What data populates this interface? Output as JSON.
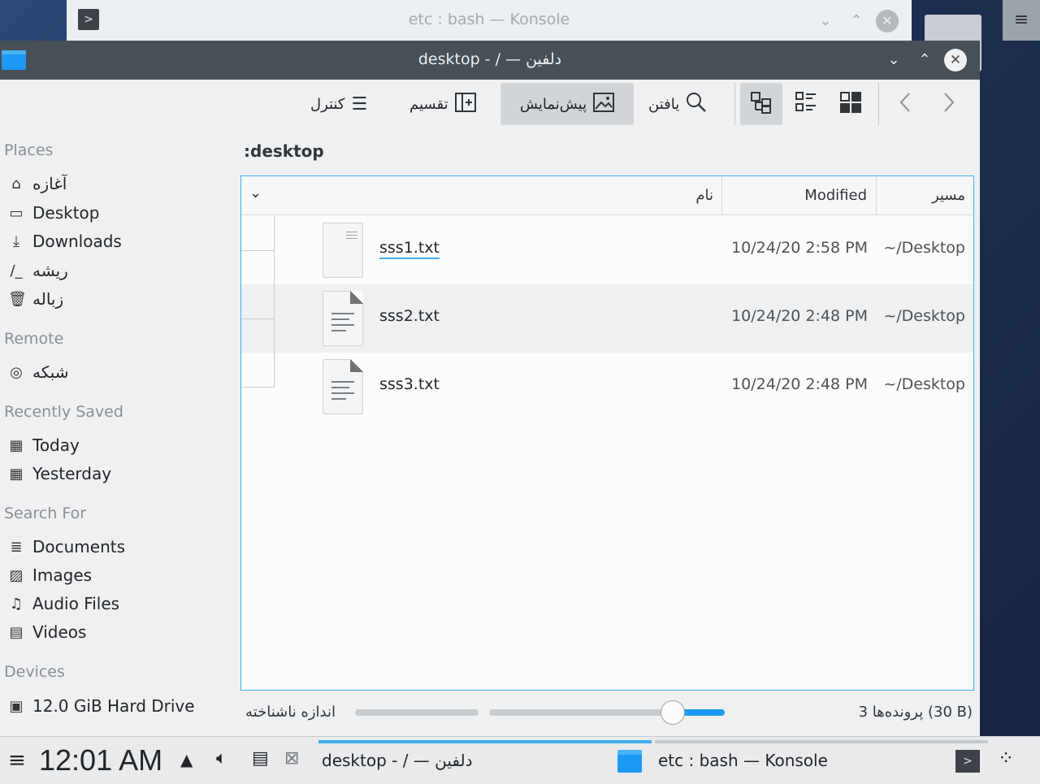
{
  "background_window": {
    "title": "etc : bash — Konsole"
  },
  "window": {
    "title": "desktop - / — دلفین"
  },
  "toolbar": {
    "control": "کنترل",
    "split": "تقسیم",
    "preview": "پیش‌نمایش",
    "find": "یافتن"
  },
  "sidebar": {
    "places_header": "Places",
    "places": [
      {
        "label": "آغازه",
        "icon": "home-icon"
      },
      {
        "label": "Desktop",
        "icon": "desktop-icon"
      },
      {
        "label": "Downloads",
        "icon": "download-icon"
      },
      {
        "label": "ریشه",
        "icon": "root-icon"
      },
      {
        "label": "زباله",
        "icon": "trash-icon"
      }
    ],
    "remote_header": "Remote",
    "remote": [
      {
        "label": "شبکه",
        "icon": "network-icon"
      }
    ],
    "recent_header": "Recently Saved",
    "recent": [
      {
        "label": "Today",
        "icon": "calendar-icon"
      },
      {
        "label": "Yesterday",
        "icon": "calendar-icon"
      }
    ],
    "search_header": "Search For",
    "search": [
      {
        "label": "Documents",
        "icon": "document-icon"
      },
      {
        "label": "Images",
        "icon": "image-icon"
      },
      {
        "label": "Audio Files",
        "icon": "music-icon"
      },
      {
        "label": "Videos",
        "icon": "video-icon"
      }
    ],
    "devices_header": "Devices",
    "devices": [
      {
        "label": "12.0 GiB Hard Drive",
        "icon": "drive-icon"
      }
    ]
  },
  "location": {
    "breadcrumb": ":desktop"
  },
  "table": {
    "columns": {
      "name": "نام",
      "modified": "Modified",
      "path": "مسیر"
    },
    "rows": [
      {
        "name": "sss1.txt",
        "modified": "10/24/20 2:58 PM",
        "path": "~/Desktop"
      },
      {
        "name": "sss2.txt",
        "modified": "10/24/20 2:48 PM",
        "path": "~/Desktop"
      },
      {
        "name": "sss3.txt",
        "modified": "10/24/20 2:48 PM",
        "path": "~/Desktop"
      }
    ]
  },
  "status": {
    "size_label": "اندازه ناشناخته",
    "summary": "3 پرونده‌ها (30 B)",
    "zoom_fraction": 0.78
  },
  "taskbar": {
    "clock": "12:01 AM",
    "tasks": [
      {
        "label": "desktop - / — دلفین"
      },
      {
        "label": "etc : bash — Konsole"
      }
    ]
  },
  "colors": {
    "accent": "#3daee9",
    "titlebar": "#475057"
  }
}
